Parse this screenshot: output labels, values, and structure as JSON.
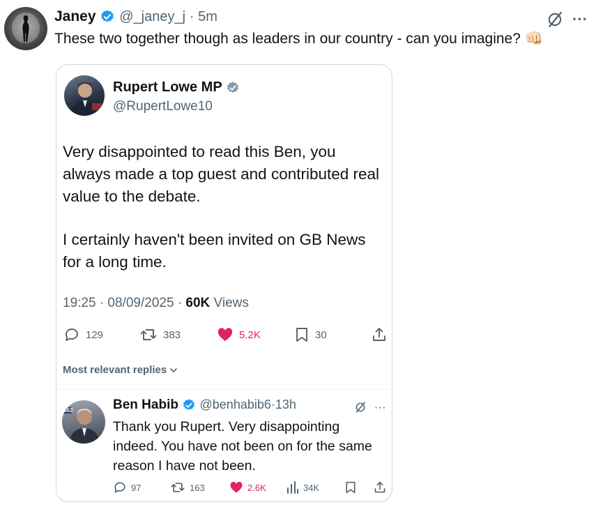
{
  "post": {
    "author_name": "Janey",
    "author_handle": "@_janey_j",
    "time": "· 5m",
    "text": "These two together though as leaders in our country - can you imagine?",
    "emoji": "👊🏻",
    "more_icon": "···"
  },
  "quoted": {
    "author_name": "Rupert Lowe MP",
    "author_handle": "@RupertLowe10",
    "paragraphs": [
      "Very disappointed to read this Ben, you always made a top guest and contributed real value to the debate.",
      "I certainly haven't been invited on GB News for a long time."
    ],
    "timestamp": "19:25 · 08/09/2025 · ",
    "views_count": "60K",
    "views_label": " Views",
    "stats": {
      "replies": "129",
      "reposts": "383",
      "likes": "5.2K",
      "bookmarks": "30"
    },
    "replies_header": "Most relevant replies"
  },
  "reply": {
    "author_name": "Ben Habib",
    "author_handle": "@benhabib6",
    "time": "·13h",
    "more_icon": "···",
    "avatar_badge": "863",
    "text": "Thank you Rupert. Very disappointing indeed. You have not been on for the same reason I have not been.",
    "stats": {
      "replies": "97",
      "reposts": "163",
      "likes": "2.6K",
      "views": "34K"
    }
  },
  "colors": {
    "verified": "#1d9bf0",
    "like": "#e0245e",
    "muted": "#536471",
    "border": "#cfd9de"
  }
}
